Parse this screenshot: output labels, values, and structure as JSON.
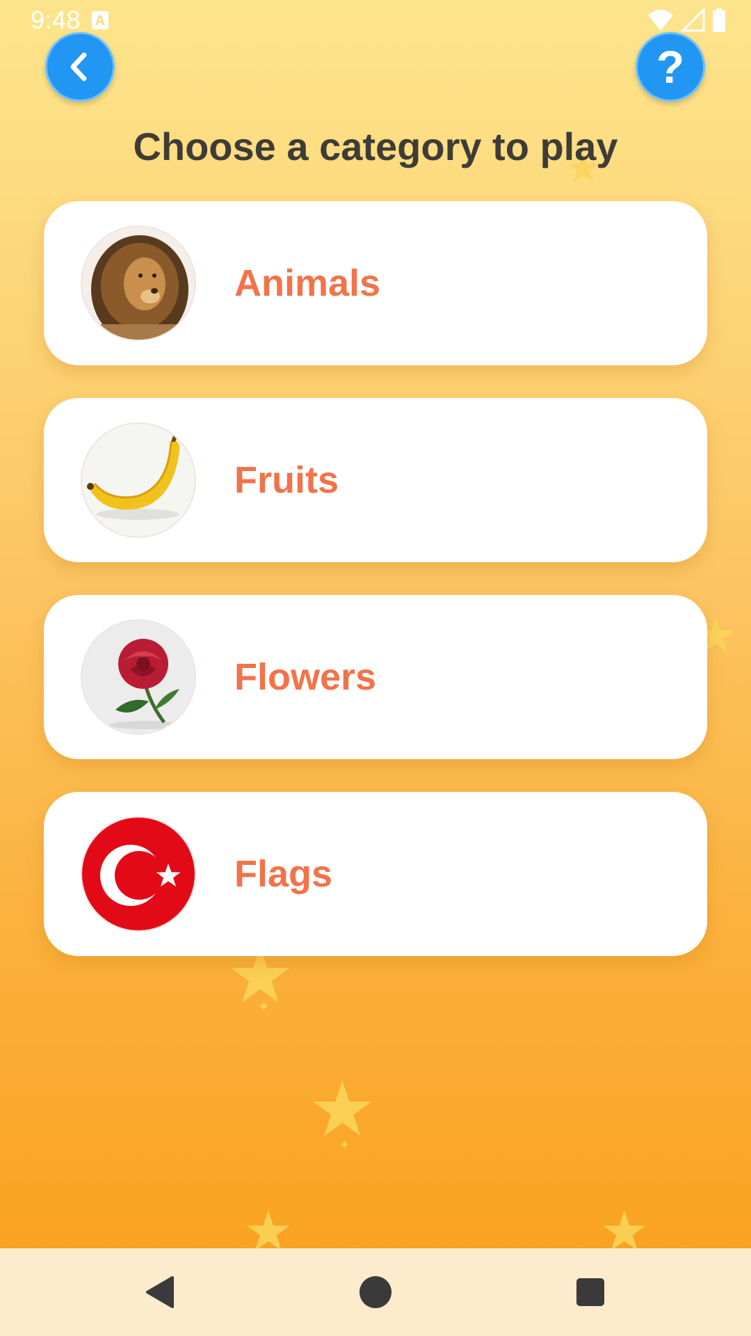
{
  "status_bar": {
    "time": "9:48",
    "notification_icon": "a-notification-icon",
    "icons": [
      "wifi-icon",
      "signal-icon",
      "battery-icon"
    ]
  },
  "header": {
    "back_icon": "chevron-left-icon",
    "help_label": "?",
    "title": "Choose a category to play"
  },
  "categories": [
    {
      "label": "Animals",
      "icon": "lion-image"
    },
    {
      "label": "Fruits",
      "icon": "banana-image"
    },
    {
      "label": "Flowers",
      "icon": "rose-image"
    },
    {
      "label": "Flags",
      "icon": "turkey-flag-image"
    }
  ],
  "colors": {
    "accent_blue": "#2196f3",
    "category_text": "#f2734a",
    "title_text": "#3f3b37",
    "background_top": "#fde58d",
    "background_bottom": "#f99e1a"
  },
  "nav_bar": {
    "buttons": [
      "nav-back-icon",
      "nav-home-icon",
      "nav-recents-icon"
    ]
  }
}
